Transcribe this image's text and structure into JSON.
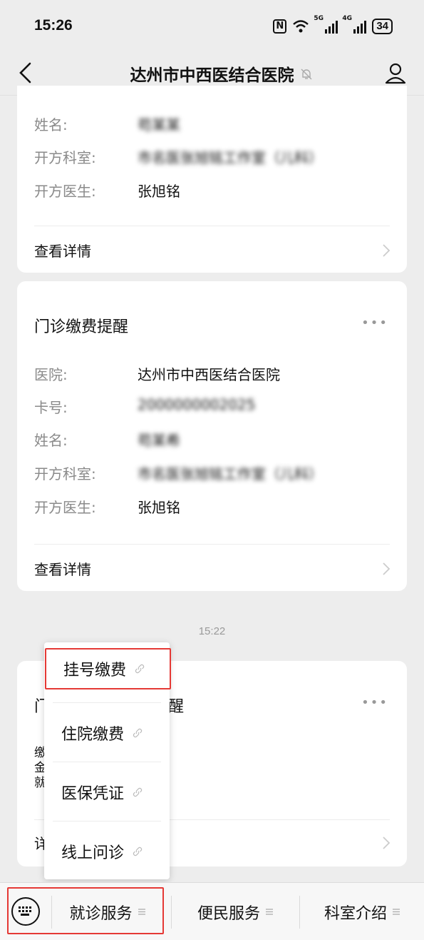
{
  "status_bar": {
    "time": "15:26",
    "nfc": "N",
    "net1": "5G",
    "net2": "4G",
    "battery": "34"
  },
  "nav": {
    "title": "达州市中西医结合医院",
    "icons": [
      "back-icon",
      "mute-icon",
      "profile-icon"
    ]
  },
  "card1": {
    "rows": [
      {
        "label": "姓名:",
        "value": "苟某某"
      },
      {
        "label": "开方科室:",
        "value": "市名医张旭铭工作室（儿科）"
      },
      {
        "label": "开方医生:",
        "value": "张旭铭"
      }
    ],
    "detail": "查看详情"
  },
  "card2": {
    "title": "门诊缴费提醒",
    "more": "•••",
    "rows": [
      {
        "label": "医院:",
        "value": "达州市中西医结合医院"
      },
      {
        "label": "卡号:",
        "value": "2000000002025"
      },
      {
        "label": "姓名:",
        "value": "苟某希"
      },
      {
        "label": "开方科室:",
        "value": "市名医张旭铭工作室（儿科）"
      },
      {
        "label": "开方医生:",
        "value": "张旭铭"
      }
    ],
    "detail": "查看详情"
  },
  "timestamp": "15:22",
  "card3": {
    "title_start": "门",
    "title_end": "醒",
    "more": "•••",
    "row_starts": [
      "缴",
      "金",
      "就"
    ],
    "detail_start": "详"
  },
  "popup": {
    "items": [
      "挂号缴费",
      "住院缴费",
      "医保凭证",
      "线上问诊"
    ]
  },
  "bottom_menu": {
    "tabs": [
      "就诊服务",
      "便民服务",
      "科室介绍"
    ]
  },
  "colors": {
    "background": "#ededed",
    "card": "#ffffff",
    "label_gray": "#8a8a8a",
    "highlight_red": "#e53935"
  }
}
